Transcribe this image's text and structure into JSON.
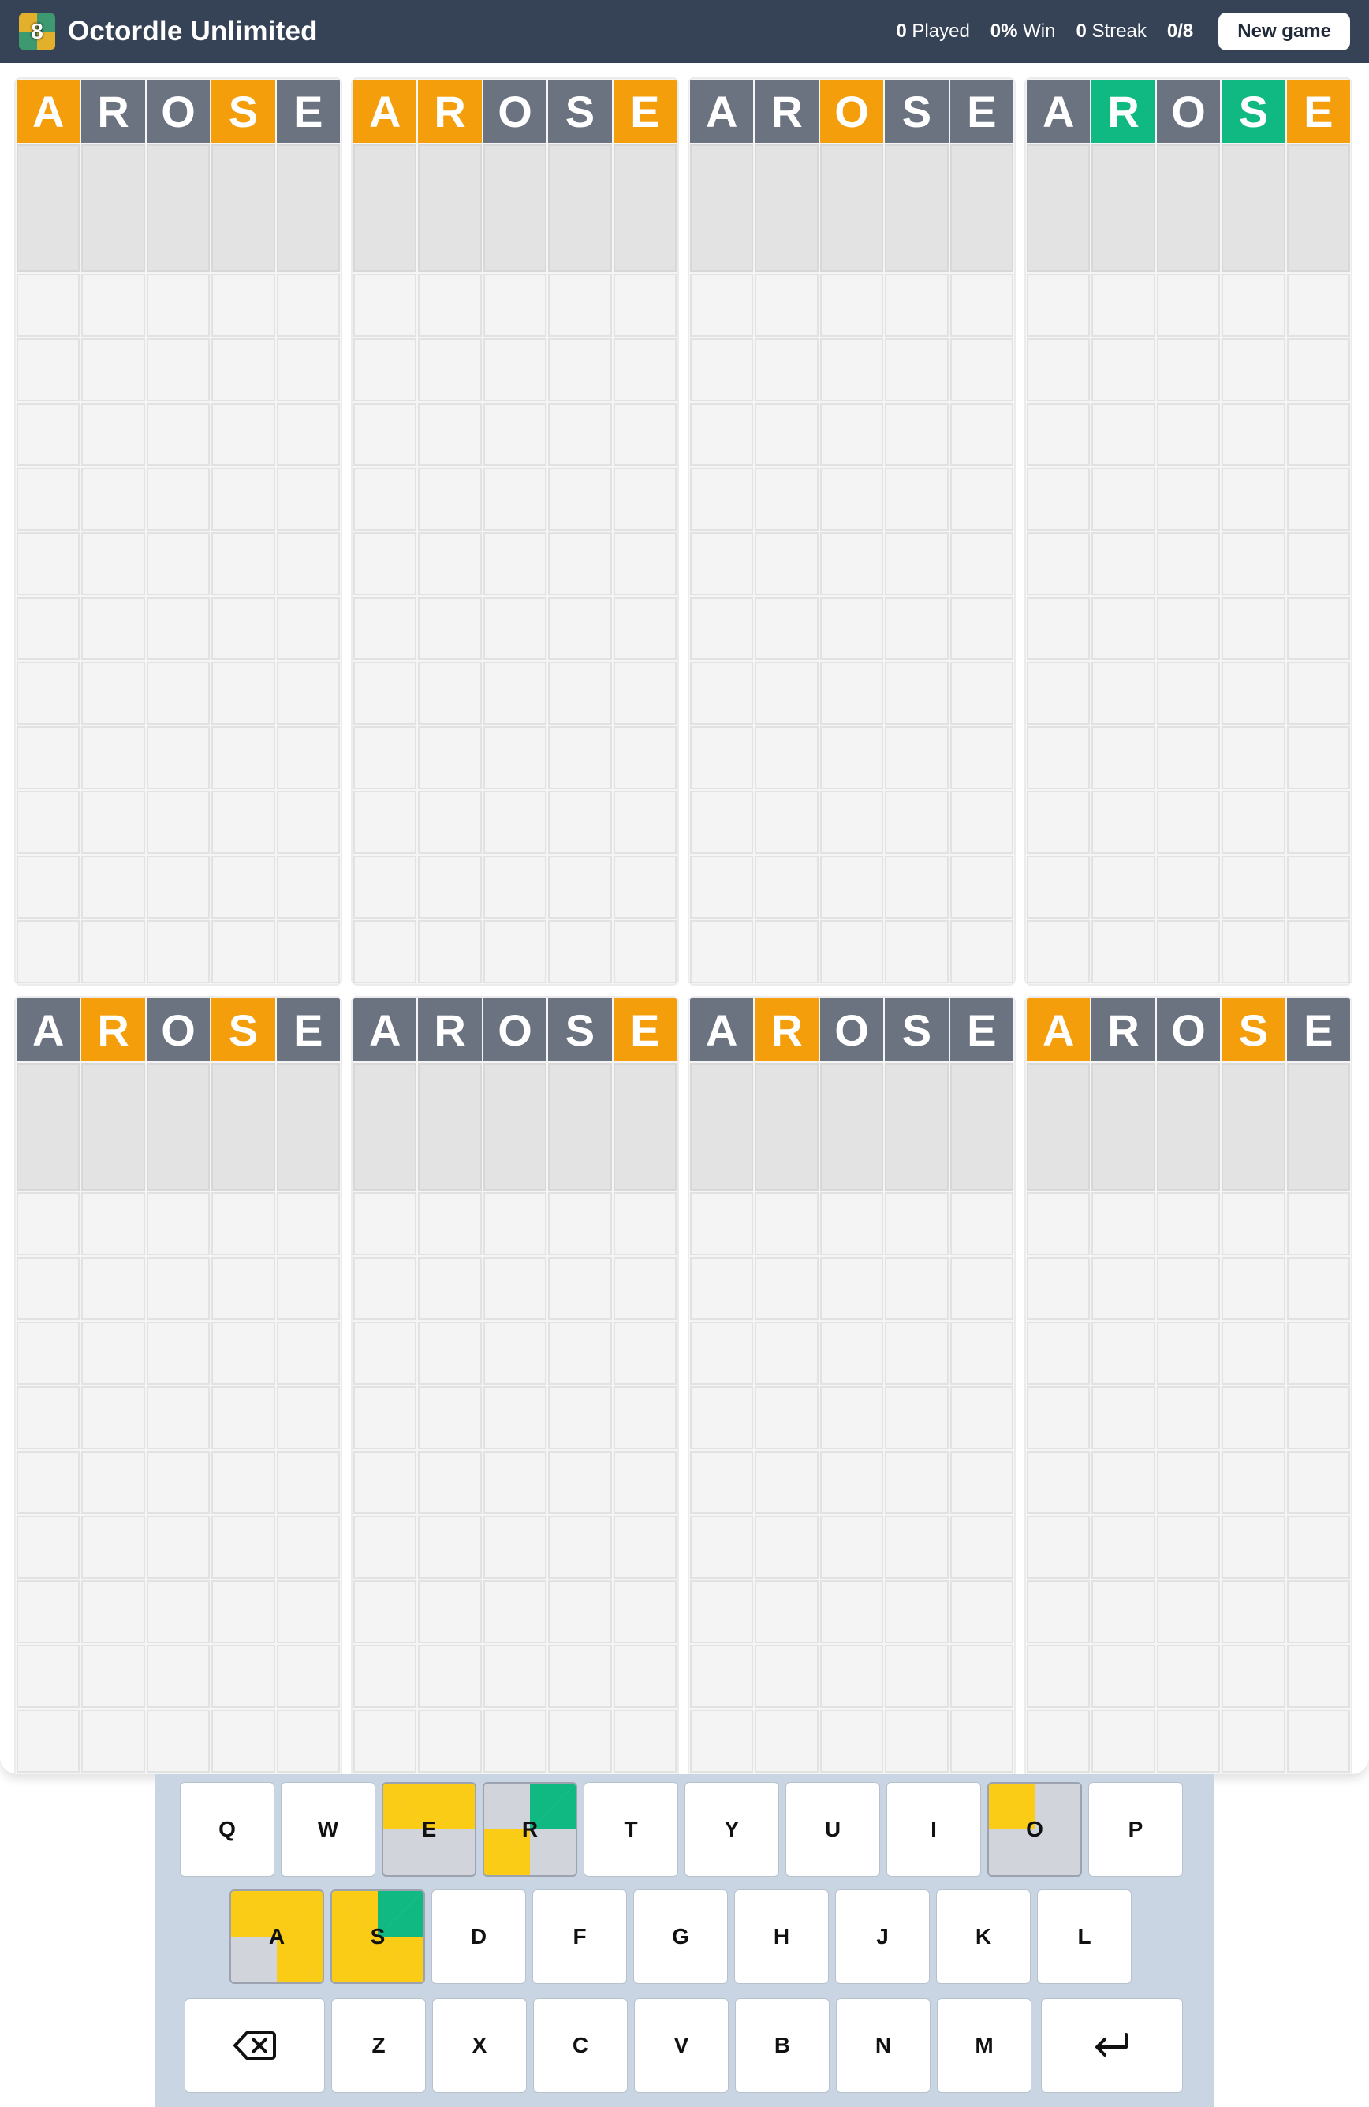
{
  "app": {
    "title": "Octordle Unlimited",
    "logo_digit": "8"
  },
  "stats": {
    "played_value": "0",
    "played_label": "Played",
    "win_value": "0%",
    "win_label": "Win",
    "streak_value": "0",
    "streak_label": "Streak",
    "progress": "0/8",
    "new_game_label": "New game"
  },
  "colors": {
    "yellow": "#f59e0b",
    "green": "#10b981",
    "gray": "#6b7280",
    "key_yellow": "#facc15",
    "key_green": "#10b981"
  },
  "guess_word": [
    "A",
    "R",
    "O",
    "S",
    "E"
  ],
  "boards": [
    {
      "id": 1,
      "states": [
        "Y",
        "B",
        "B",
        "Y",
        "B"
      ]
    },
    {
      "id": 2,
      "states": [
        "Y",
        "Y",
        "B",
        "B",
        "Y"
      ]
    },
    {
      "id": 3,
      "states": [
        "B",
        "B",
        "Y",
        "B",
        "B"
      ]
    },
    {
      "id": 4,
      "states": [
        "B",
        "G",
        "B",
        "G",
        "Y"
      ]
    },
    {
      "id": 5,
      "states": [
        "B",
        "Y",
        "B",
        "Y",
        "B"
      ]
    },
    {
      "id": 6,
      "states": [
        "B",
        "B",
        "B",
        "B",
        "Y"
      ]
    },
    {
      "id": 7,
      "states": [
        "B",
        "Y",
        "B",
        "B",
        "B"
      ]
    },
    {
      "id": 8,
      "states": [
        "Y",
        "B",
        "B",
        "Y",
        "B"
      ]
    }
  ],
  "keyboard": {
    "row1": [
      "Q",
      "W",
      "E",
      "R",
      "T",
      "Y",
      "U",
      "I",
      "O",
      "P"
    ],
    "row2": [
      "A",
      "S",
      "D",
      "F",
      "G",
      "H",
      "J",
      "K",
      "L"
    ],
    "row3": [
      "Z",
      "X",
      "C",
      "V",
      "B",
      "N",
      "M"
    ],
    "backspace_icon": "backspace-icon",
    "enter_icon": "enter-icon",
    "key_hints": {
      "E": [
        "Y",
        "Y",
        "_",
        "_"
      ],
      "R": [
        "_",
        "G",
        "Y",
        "_"
      ],
      "O": [
        "Y",
        "_",
        "_",
        "_"
      ],
      "A": [
        "Y",
        "Y",
        "_",
        "Y"
      ],
      "S": [
        "Y",
        "G",
        "Y",
        "Y"
      ]
    }
  }
}
